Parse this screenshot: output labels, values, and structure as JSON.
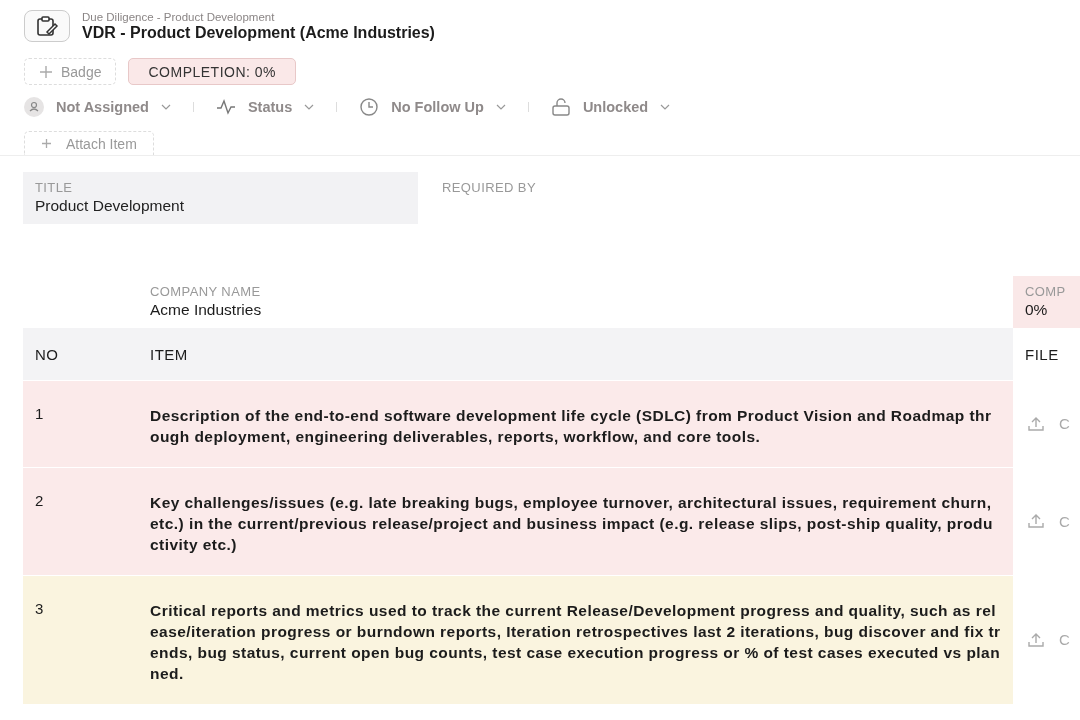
{
  "header": {
    "breadcrumb": "Due Diligence - Product Development",
    "title": "VDR - Product Development (Acme Industries)"
  },
  "badges": {
    "add_label": "Badge",
    "completion": "COMPLETION: 0%"
  },
  "filters": [
    {
      "kind": "person",
      "label": "Not Assigned"
    },
    {
      "kind": "status",
      "label": "Status"
    },
    {
      "kind": "clock",
      "label": "No Follow Up"
    },
    {
      "kind": "lock",
      "label": "Unlocked"
    }
  ],
  "attach": {
    "label": "Attach Item"
  },
  "fields": [
    {
      "label": "TITLE",
      "value": "Product Development",
      "filled": true
    },
    {
      "label": "REQUIRED BY",
      "filled": false
    }
  ],
  "summary": {
    "company_label": "COMPANY NAME",
    "company_value": "Acme Industries",
    "completion_label": "COMP",
    "completion_value": "0%"
  },
  "table": {
    "columns": [
      "NO",
      "ITEM",
      "FILE"
    ],
    "rows": [
      {
        "no": "1",
        "item": "Description of the end-to-end software development life cycle (SDLC) from Product Vision and Roadmap through deployment, engineering deliverables, reports, workflow, and core tools.",
        "file": "C",
        "color": "#fbeaea"
      },
      {
        "no": "2",
        "item": "Key challenges/issues (e.g. late breaking bugs, employee turnover, architectural issues, requirement churn, etc.) in the current/previous release/project and business impact (e.g. release slips, post-ship quality, productivity etc.)",
        "file": "C",
        "color": "#fbeaea"
      },
      {
        "no": "3",
        "item": "Critical reports and metrics used to track the current Release/Development progress and quality, such as release/iteration progress or burndown reports, Iteration retrospectives last 2 iterations, bug discover and fix trends, bug status, current open bug counts, test case execution progress or % of test cases executed vs planned.",
        "file": "C",
        "color": "#faf4df"
      }
    ]
  }
}
